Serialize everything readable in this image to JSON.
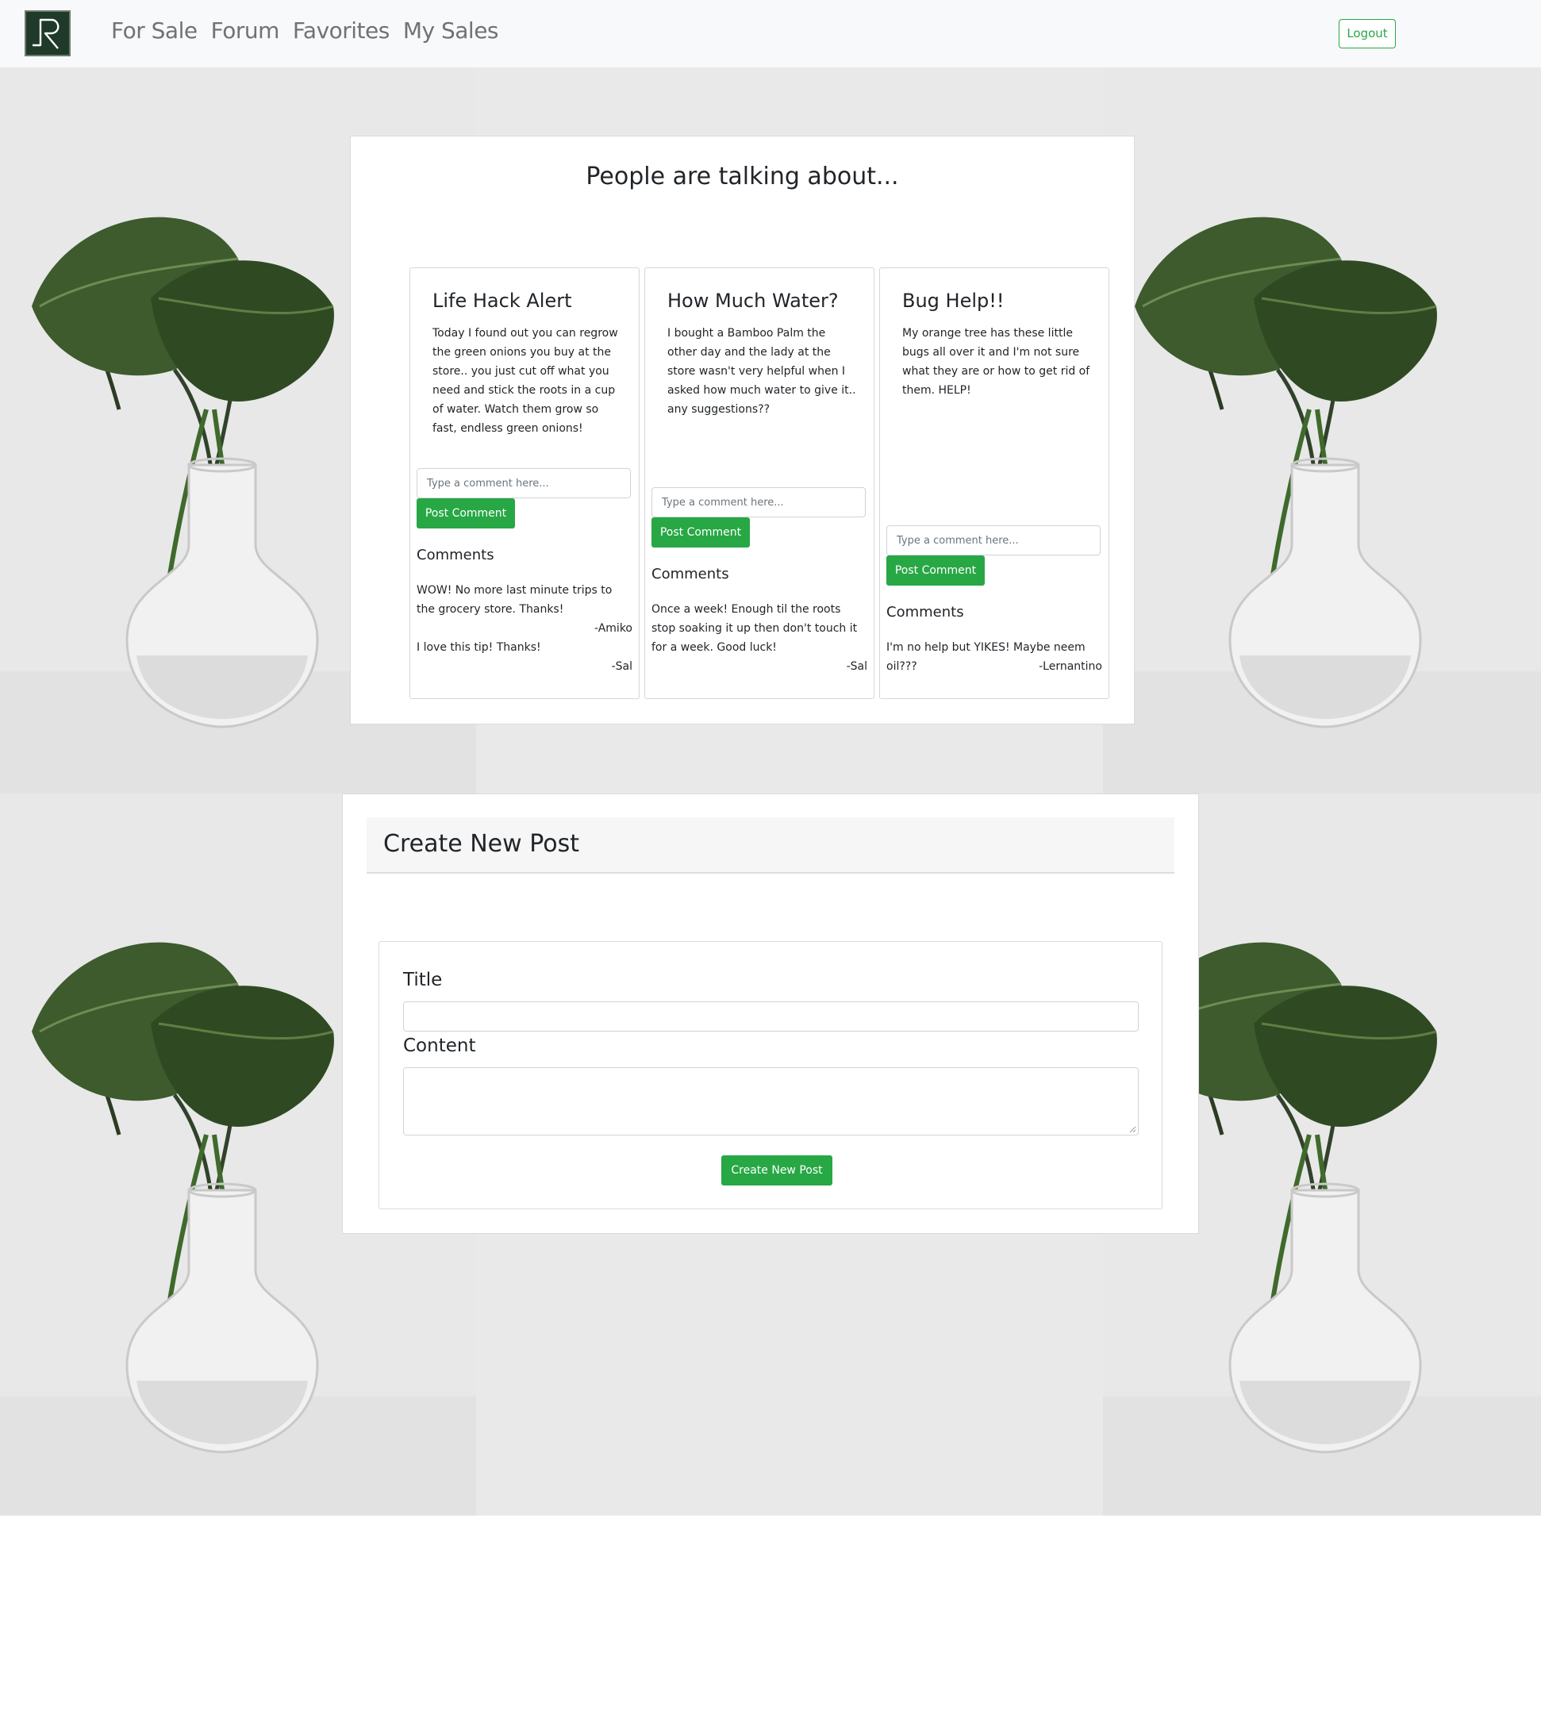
{
  "navbar": {
    "logo_icon": "leaf-r-logo-icon",
    "links": [
      "For Sale",
      "Forum",
      "Favorites",
      "My Sales"
    ],
    "logout_label": "Logout"
  },
  "forum": {
    "heading": "People are talking about...",
    "comment_placeholder": "Type a comment here...",
    "post_comment_label": "Post Comment",
    "comments_heading": "Comments",
    "posts": [
      {
        "title": "Life Hack Alert",
        "body": "Today I found out you can regrow the green onions you buy at the store.. you just cut off what you need and stick the roots in a cup of water. Watch them grow so fast, endless green onions!",
        "comments": [
          {
            "text": "WOW! No more last minute trips to the grocery store. Thanks!",
            "author": "-Amiko"
          },
          {
            "text": "I love this tip! Thanks!",
            "author": "-Sal"
          }
        ]
      },
      {
        "title": "How Much Water?",
        "body": "I bought a Bamboo Palm the other day and the lady at the store wasn't very helpful when I asked how much water to give it.. any suggestions??",
        "comments": [
          {
            "text": "Once a week! Enough til the roots stop soaking it up then don't touch it for a week. Good luck!",
            "author": "-Sal"
          }
        ]
      },
      {
        "title": "Bug Help!!",
        "body": "My orange tree has these little bugs all over it and I'm not sure what they are or how to get rid of them. HELP!",
        "comments": [
          {
            "text": "I'm no help but YIKES! Maybe neem oil???",
            "author": "-Lernantino"
          }
        ]
      }
    ]
  },
  "create_post": {
    "header": "Create New Post",
    "title_label": "Title",
    "title_value": "",
    "content_label": "Content",
    "content_value": "",
    "submit_label": "Create New Post"
  },
  "colors": {
    "accent_green": "#28a745",
    "logo_green": "#203a2a",
    "navbar_bg": "#f8f9fa",
    "page_bg": "#e9e9e9"
  }
}
